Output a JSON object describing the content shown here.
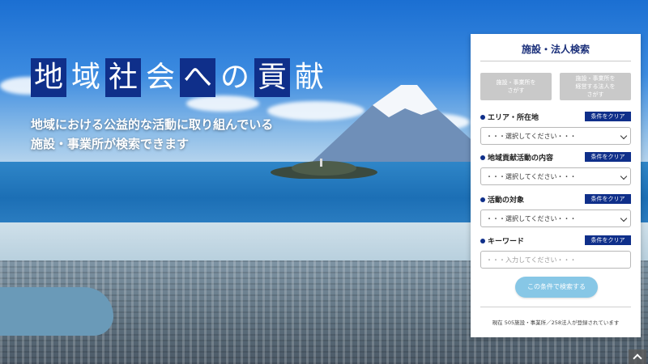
{
  "hero": {
    "headline_chars": [
      {
        "char": "地",
        "boxed": true
      },
      {
        "char": "域",
        "boxed": false
      },
      {
        "char": "社",
        "boxed": true
      },
      {
        "char": "会",
        "boxed": false
      },
      {
        "char": "へ",
        "boxed": true
      },
      {
        "char": "の",
        "boxed": false
      },
      {
        "char": "貢",
        "boxed": true
      },
      {
        "char": "献",
        "boxed": false
      }
    ],
    "subtext_line1": "地域における公益的な活動に取り組んでいる",
    "subtext_line2": "施設・事業所が検索できます"
  },
  "colors": {
    "accent_navy": "#0f2f8a",
    "search_button": "#87c7e6",
    "mode_button_gray": "#c9c9c9"
  },
  "panel": {
    "title": "施設・法人検索",
    "mode_facility": "施設・事業所を\nさがす",
    "mode_corporation": "施設・事業所を\n経営する法人を\nさがす",
    "sections": [
      {
        "label": "エリア・所在地",
        "clear": "条件をクリア",
        "placeholder": "・・・選択してください・・・"
      },
      {
        "label": "地域貢献活動の内容",
        "clear": "条件をクリア",
        "placeholder": "・・・選択してください・・・"
      },
      {
        "label": "活動の対象",
        "clear": "条件をクリア",
        "placeholder": "・・・選択してください・・・"
      }
    ],
    "keyword": {
      "label": "キーワード",
      "clear": "条件をクリア",
      "placeholder": "・・・入力してください・・・"
    },
    "search_button": "この条件で検索する",
    "footer_note": "現在 505施設・事業所／258法人が登録されています"
  },
  "icons": {
    "scroll_top": "chevron-up-icon"
  }
}
